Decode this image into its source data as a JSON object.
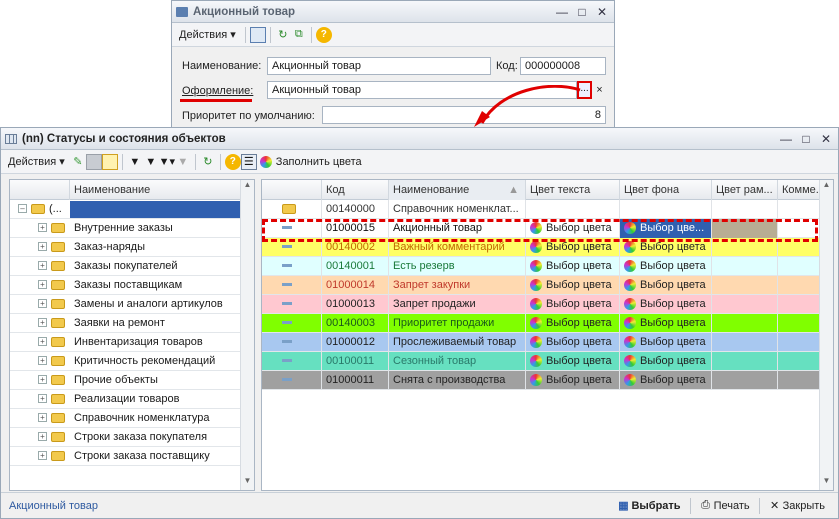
{
  "dialog": {
    "title": "Акционный товар",
    "actions_label": "Действия",
    "name_label": "Наименование:",
    "name_value": "Акционный товар",
    "code_label": "Код:",
    "code_value": "000000008",
    "design_label": "Оформление:",
    "design_value": "Акционный товар",
    "design_pick": "...",
    "design_clear": "×",
    "priority_label": "Приоритет по умолчанию:",
    "priority_value": "8"
  },
  "main": {
    "title": "(nn) Статусы и состояния объектов",
    "actions_label": "Действия",
    "fill_colors_label": "Заполнить цвета",
    "tree_header": "Наименование",
    "tree_root": "(...",
    "tree_items": [
      "Внутренние заказы",
      "Заказ-наряды",
      "Заказы покупателей",
      "Заказы поставщикам",
      "Замены и аналоги артикулов",
      "Заявки на ремонт",
      "Инвентаризация товаров",
      "Критичность рекомендаций",
      "Прочие объекты",
      "Реализации товаров",
      "Справочник номенклатура",
      "Строки заказа покупателя",
      "Строки заказа поставщику"
    ],
    "columns": [
      "Код",
      "Наименование",
      "Цвет текста",
      "Цвет фона",
      "Цвет рам...",
      "Комме..."
    ],
    "rows": [
      {
        "code": "00140000",
        "name": "Справочник номенклат...",
        "text_color": "",
        "bg_color": "",
        "bg": "#ffffff",
        "fg": "#333333",
        "folder": true
      },
      {
        "code": "01000015",
        "name": "Акционный товар",
        "text_color": "Выбор цвета",
        "bg_color": "Выбор цве...",
        "bg": "#ffffff",
        "fg": "#111111",
        "folder": false
      },
      {
        "code": "00140002",
        "name": "Важный комментарий",
        "text_color": "Выбор цвета",
        "bg_color": "Выбор цвета",
        "bg": "#ffff66",
        "fg": "#c06a00",
        "folder": false
      },
      {
        "code": "00140001",
        "name": "Есть резерв",
        "text_color": "Выбор цвета",
        "bg_color": "Выбор цвета",
        "bg": "#e0ffff",
        "fg": "#1a7a3a",
        "folder": false
      },
      {
        "code": "01000014",
        "name": "Запрет закупки",
        "text_color": "Выбор цвета",
        "bg_color": "Выбор цвета",
        "bg": "#ffd9b0",
        "fg": "#c0392b",
        "folder": false
      },
      {
        "code": "01000013",
        "name": "Запрет продажи",
        "text_color": "Выбор цвета",
        "bg_color": "Выбор цвета",
        "bg": "#ffc8d0",
        "fg": "#222222",
        "folder": false
      },
      {
        "code": "00140003",
        "name": "Приоритет продажи",
        "text_color": "Выбор цвета",
        "bg_color": "Выбор цвета",
        "bg": "#80ff00",
        "fg": "#1a5a1a",
        "folder": false
      },
      {
        "code": "01000012",
        "name": "Прослеживаемый товар",
        "text_color": "Выбор цвета",
        "bg_color": "Выбор цвета",
        "bg": "#a8c8f0",
        "fg": "#222222",
        "folder": false
      },
      {
        "code": "00100011",
        "name": "Сезонный товар",
        "text_color": "Выбор цвета",
        "bg_color": "Выбор цвета",
        "bg": "#66e0c0",
        "fg": "#2a7a6a",
        "folder": false
      },
      {
        "code": "01000011",
        "name": "Снята с производства",
        "text_color": "Выбор цвета",
        "bg_color": "Выбор цвета",
        "bg": "#a0a0a0",
        "fg": "#222222",
        "folder": false
      }
    ],
    "status_text": "Акционный товар",
    "select_label": "Выбрать",
    "print_label": "Печать",
    "close_label": "Закрыть"
  },
  "colors": {
    "highlight": "#e00000",
    "selection": "#3060b0"
  }
}
